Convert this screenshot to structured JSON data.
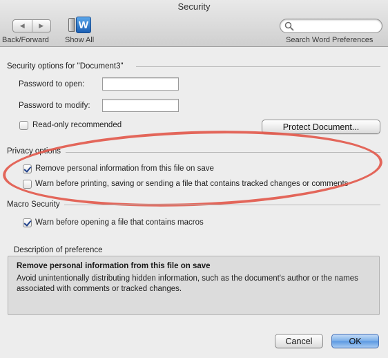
{
  "window": {
    "title": "Security"
  },
  "toolbar": {
    "back_forward_label": "Back/Forward",
    "show_all_label": "Show All",
    "show_all_icon_letter": "W",
    "search_placeholder": "",
    "search_label": "Search Word Preferences"
  },
  "security_section": {
    "header": "Security options for \"Document3\"",
    "password_open_label": "Password to open:",
    "password_open_value": "",
    "password_modify_label": "Password to modify:",
    "password_modify_value": "",
    "readonly_label": "Read-only recommended",
    "readonly_checked": false,
    "protect_button": "Protect Document..."
  },
  "privacy_section": {
    "header": "Privacy options",
    "remove_personal_label": "Remove personal information from this file on save",
    "remove_personal_checked": true,
    "warn_tracked_label": "Warn before printing, saving or sending a file that contains tracked changes or comments",
    "warn_tracked_checked": false
  },
  "macro_section": {
    "header": "Macro Security",
    "warn_macros_label": "Warn before opening a file that contains macros",
    "warn_macros_checked": true
  },
  "description": {
    "header": "Description of preference",
    "title": "Remove personal information from this file on save",
    "text": "Avoid unintentionally distributing hidden information, such as the document's author or the names associated with comments or tracked changes."
  },
  "buttons": {
    "cancel": "Cancel",
    "ok": "OK"
  },
  "colors": {
    "highlight": "#e25a4d",
    "default_button": "#5a98e2",
    "check": "#1e3f8a"
  }
}
